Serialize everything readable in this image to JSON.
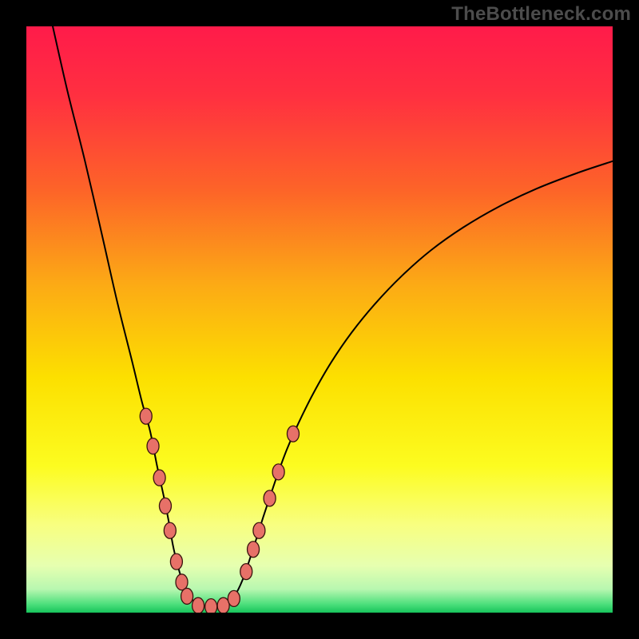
{
  "watermark": "TheBottleneck.com",
  "chart_data": {
    "type": "line",
    "title": "",
    "xlabel": "",
    "ylabel": "",
    "xlim": [
      0,
      100
    ],
    "ylim": [
      0,
      100
    ],
    "background": {
      "style": "vertical_gradient",
      "stops": [
        {
          "offset": 0.0,
          "color": "#ff1b4a"
        },
        {
          "offset": 0.12,
          "color": "#ff3040"
        },
        {
          "offset": 0.28,
          "color": "#fd6428"
        },
        {
          "offset": 0.44,
          "color": "#fcaa15"
        },
        {
          "offset": 0.6,
          "color": "#fce000"
        },
        {
          "offset": 0.75,
          "color": "#fcfc20"
        },
        {
          "offset": 0.85,
          "color": "#f8ff80"
        },
        {
          "offset": 0.92,
          "color": "#e6ffb0"
        },
        {
          "offset": 0.96,
          "color": "#b8f7b0"
        },
        {
          "offset": 0.985,
          "color": "#4fe07d"
        },
        {
          "offset": 1.0,
          "color": "#17c45b"
        }
      ]
    },
    "series": [
      {
        "name": "curve",
        "color": "#000000",
        "width": 2,
        "points": [
          {
            "x": 4.5,
            "y": 100
          },
          {
            "x": 7,
            "y": 89
          },
          {
            "x": 10,
            "y": 77
          },
          {
            "x": 13,
            "y": 64
          },
          {
            "x": 15.5,
            "y": 53
          },
          {
            "x": 18,
            "y": 43
          },
          {
            "x": 19.7,
            "y": 36
          },
          {
            "x": 21.1,
            "y": 31
          },
          {
            "x": 22.3,
            "y": 25
          },
          {
            "x": 23.4,
            "y": 20
          },
          {
            "x": 24.2,
            "y": 16
          },
          {
            "x": 25.0,
            "y": 11.5
          },
          {
            "x": 25.7,
            "y": 8.5
          },
          {
            "x": 26.5,
            "y": 5.7
          },
          {
            "x": 27.3,
            "y": 3.6
          },
          {
            "x": 28.3,
            "y": 2.2
          },
          {
            "x": 29.5,
            "y": 1.4
          },
          {
            "x": 31.0,
            "y": 1.1
          },
          {
            "x": 32.8,
            "y": 1.1
          },
          {
            "x": 34.3,
            "y": 1.6
          },
          {
            "x": 35.6,
            "y": 3.0
          },
          {
            "x": 36.8,
            "y": 5.4
          },
          {
            "x": 38.0,
            "y": 8.8
          },
          {
            "x": 39.2,
            "y": 12.5
          },
          {
            "x": 40.4,
            "y": 16.3
          },
          {
            "x": 41.7,
            "y": 20.2
          },
          {
            "x": 43.0,
            "y": 24.0
          },
          {
            "x": 44.5,
            "y": 28.0
          },
          {
            "x": 46.5,
            "y": 32.5
          },
          {
            "x": 49.0,
            "y": 37.5
          },
          {
            "x": 52.0,
            "y": 42.7
          },
          {
            "x": 55.5,
            "y": 47.8
          },
          {
            "x": 59.5,
            "y": 52.7
          },
          {
            "x": 64.0,
            "y": 57.4
          },
          {
            "x": 69.0,
            "y": 61.8
          },
          {
            "x": 74.5,
            "y": 65.7
          },
          {
            "x": 80.5,
            "y": 69.2
          },
          {
            "x": 87.0,
            "y": 72.3
          },
          {
            "x": 94.0,
            "y": 75.0
          },
          {
            "x": 100.0,
            "y": 77.0
          }
        ]
      }
    ],
    "markers": {
      "color": "#e77168",
      "stroke": "#3a130e",
      "stroke_width": 1.3,
      "rx": 7.5,
      "ry": 10,
      "points": [
        {
          "x": 20.4,
          "y": 33.5
        },
        {
          "x": 21.6,
          "y": 28.4
        },
        {
          "x": 22.7,
          "y": 23.0
        },
        {
          "x": 23.7,
          "y": 18.2
        },
        {
          "x": 24.5,
          "y": 14.0
        },
        {
          "x": 25.6,
          "y": 8.7
        },
        {
          "x": 26.5,
          "y": 5.2
        },
        {
          "x": 27.4,
          "y": 2.8
        },
        {
          "x": 29.3,
          "y": 1.2
        },
        {
          "x": 31.5,
          "y": 1.0
        },
        {
          "x": 33.6,
          "y": 1.2
        },
        {
          "x": 35.4,
          "y": 2.4
        },
        {
          "x": 37.5,
          "y": 7.0
        },
        {
          "x": 38.7,
          "y": 10.8
        },
        {
          "x": 39.7,
          "y": 14.0
        },
        {
          "x": 41.5,
          "y": 19.5
        },
        {
          "x": 43.0,
          "y": 24.0
        },
        {
          "x": 45.5,
          "y": 30.5
        }
      ]
    }
  }
}
